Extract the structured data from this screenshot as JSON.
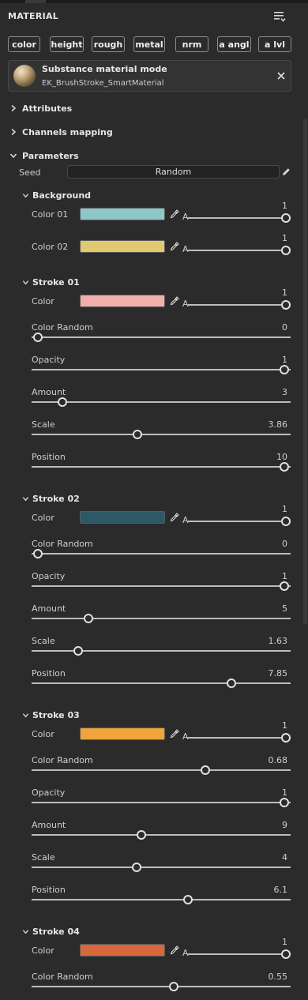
{
  "panel": {
    "title": "MATERIAL",
    "menu_icon": "list-menu-icon"
  },
  "channels": [
    {
      "label": "color"
    },
    {
      "label": "height"
    },
    {
      "label": "rough"
    },
    {
      "label": "metal"
    },
    {
      "label": "nrm"
    },
    {
      "label": "a angl"
    },
    {
      "label": "a lvl"
    }
  ],
  "material": {
    "mode": "Substance material mode",
    "name": "EK_BrushStroke_SmartMaterial",
    "close_icon": "close-icon"
  },
  "sections": {
    "attributes": "Attributes",
    "channels_mapping": "Channels mapping",
    "parameters": "Parameters"
  },
  "seed": {
    "label": "Seed",
    "value": "Random"
  },
  "color_alpha_label": "A",
  "groups": [
    {
      "title": "Background",
      "params": [
        {
          "label": "Color 01",
          "type": "color",
          "color": "#8dc7c8",
          "value": "1",
          "fraction": 1.0
        },
        {
          "label": "Color 02",
          "type": "color",
          "color": "#e0c970",
          "value": "1",
          "fraction": 1.0
        }
      ]
    },
    {
      "title": "Stroke 01",
      "params": [
        {
          "label": "Color",
          "type": "color",
          "color": "#f1aeaa",
          "value": "1",
          "fraction": 1.0
        },
        {
          "label": "Color Random",
          "type": "slider",
          "value": "0",
          "fraction": 0.0
        },
        {
          "label": "Opacity",
          "type": "slider",
          "value": "1",
          "fraction": 1.0
        },
        {
          "label": "Amount",
          "type": "slider",
          "value": "3",
          "fraction": 0.1
        },
        {
          "label": "Scale",
          "type": "slider",
          "value": "3.86",
          "fraction": 0.405
        },
        {
          "label": "Position",
          "type": "slider",
          "value": "10",
          "fraction": 1.0
        }
      ]
    },
    {
      "title": "Stroke 02",
      "params": [
        {
          "label": "Color",
          "type": "color",
          "color": "#2f5866",
          "value": "1",
          "fraction": 1.0
        },
        {
          "label": "Color Random",
          "type": "slider",
          "value": "0",
          "fraction": 0.0
        },
        {
          "label": "Opacity",
          "type": "slider",
          "value": "1",
          "fraction": 1.0
        },
        {
          "label": "Amount",
          "type": "slider",
          "value": "5",
          "fraction": 0.205
        },
        {
          "label": "Scale",
          "type": "slider",
          "value": "1.63",
          "fraction": 0.163
        },
        {
          "label": "Position",
          "type": "slider",
          "value": "7.85",
          "fraction": 0.785
        }
      ]
    },
    {
      "title": "Stroke 03",
      "params": [
        {
          "label": "Color",
          "type": "color",
          "color": "#f0a43c",
          "value": "1",
          "fraction": 1.0
        },
        {
          "label": "Color Random",
          "type": "slider",
          "value": "0.68",
          "fraction": 0.68
        },
        {
          "label": "Opacity",
          "type": "slider",
          "value": "1",
          "fraction": 1.0
        },
        {
          "label": "Amount",
          "type": "slider",
          "value": "9",
          "fraction": 0.42
        },
        {
          "label": "Scale",
          "type": "slider",
          "value": "4",
          "fraction": 0.4
        },
        {
          "label": "Position",
          "type": "slider",
          "value": "6.1",
          "fraction": 0.61
        }
      ]
    },
    {
      "title": "Stroke 04",
      "params": [
        {
          "label": "Color",
          "type": "color",
          "color": "#d8673a",
          "value": "1",
          "fraction": 1.0
        },
        {
          "label": "Color Random",
          "type": "slider",
          "value": "0.55",
          "fraction": 0.55
        }
      ]
    }
  ]
}
